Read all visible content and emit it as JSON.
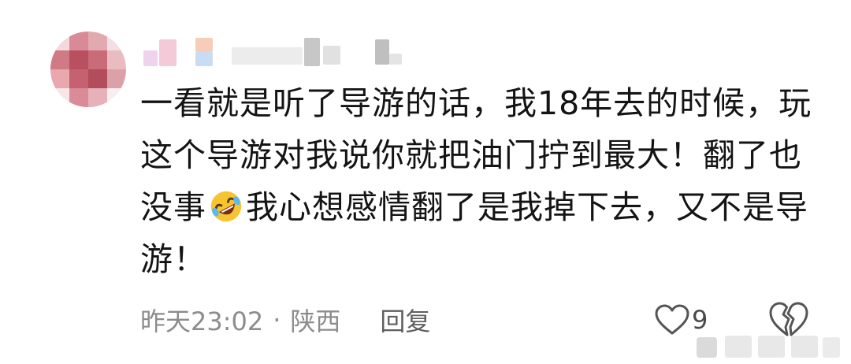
{
  "comment": {
    "text": "一看就是听了导游的话，我18年去的时候，玩这个导游对我说你就把油门拧到最大！翻了也没事",
    "text_after_emoji": "我心想感情翻了是我掉下去，又不是导游！",
    "emoji": "rofl-emoji",
    "time": "昨天23:02",
    "separator": "·",
    "location": "陕西",
    "reply_label": "回复",
    "like_count": "9"
  },
  "icons": {
    "like": "heart-outline-icon",
    "dislike": "broken-heart-outline-icon"
  },
  "colors": {
    "text": "#141414",
    "meta": "#8c8c8c",
    "background": "#ffffff"
  }
}
